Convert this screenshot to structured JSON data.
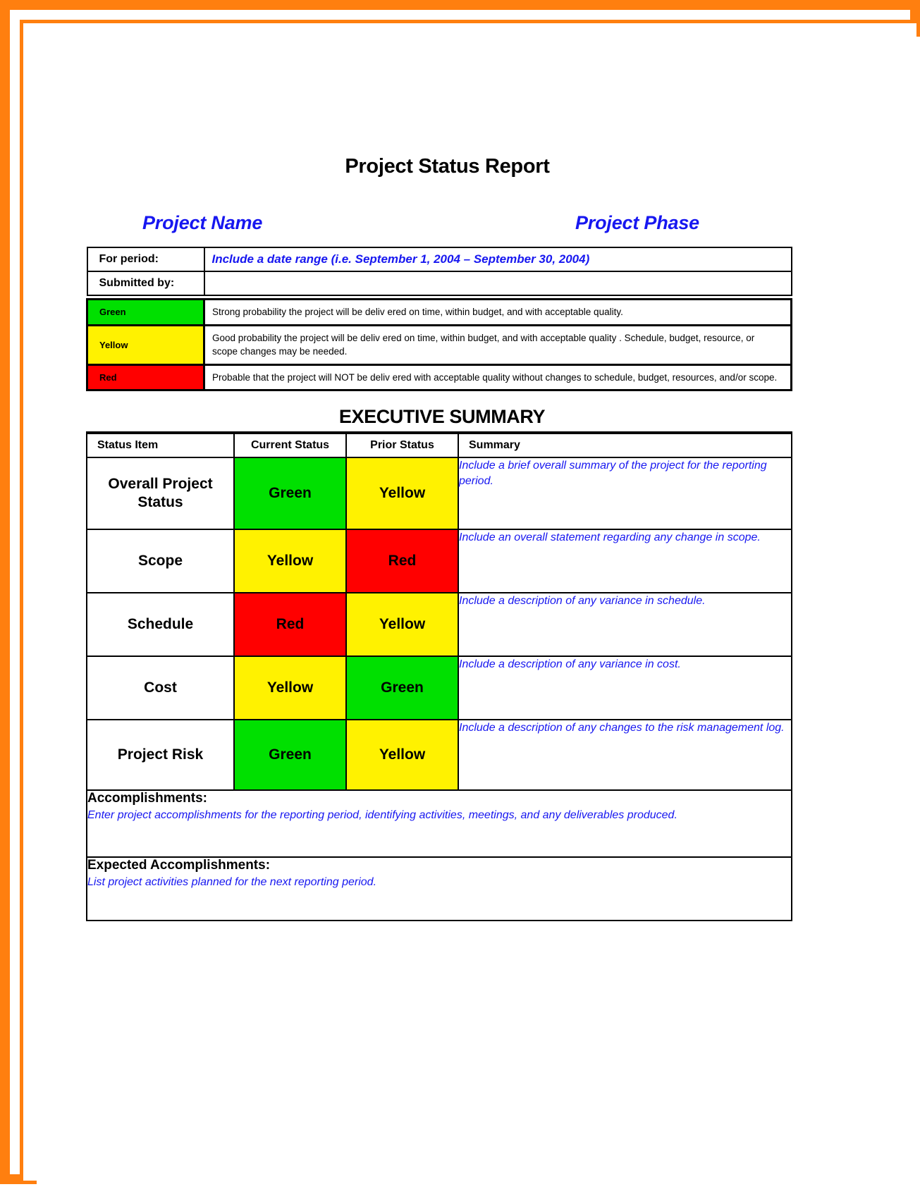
{
  "document": {
    "title": "Project Status Report",
    "project_name": "Project Name",
    "project_phase": "Project Phase",
    "executive_summary_title": "EXECUTIVE SUMMARY"
  },
  "header": {
    "for_period_label": "For period:",
    "for_period_value": "Include a date range (i.e. September 1, 2004 – September 30, 2004)",
    "submitted_by_label": "Submitted by:",
    "submitted_by_value": ""
  },
  "legend": {
    "rows": [
      {
        "color_label": "Green",
        "color_hex": "#00E000",
        "description": "Strong probability  the project will be deliv ered on time, within budget, and with acceptable quality."
      },
      {
        "color_label": "Yellow",
        "color_hex": "#FFF200",
        "description": "Good probability the project will be deliv ered on time, within budget, and with acceptable quality . Schedule, budget, resource, or scope changes may be needed."
      },
      {
        "color_label": "Red",
        "color_hex": "#FF0000",
        "description": "Probable that the project will NOT be deliv ered with acceptable quality without changes to schedule, budget, resources, and/or scope."
      }
    ]
  },
  "exec_summary": {
    "columns": [
      "Status Item",
      "Current Status",
      "Prior Status",
      "Summary"
    ],
    "rows": [
      {
        "item": "Overall Project Status",
        "current_status": "Green",
        "current_color": "#00E000",
        "prior_status": "Yellow",
        "prior_color": "#FFF200",
        "summary": "Include a brief overall summary of the project for the reporting period."
      },
      {
        "item": "Scope",
        "current_status": "Yellow",
        "current_color": "#FFF200",
        "prior_status": "Red",
        "prior_color": "#FF0000",
        "summary": "Include an overall statement regarding any change in scope."
      },
      {
        "item": "Schedule",
        "current_status": "Red",
        "current_color": "#FF0000",
        "prior_status": "Yellow",
        "prior_color": "#FFF200",
        "summary": "Include a description of any variance in schedule."
      },
      {
        "item": "Cost",
        "current_status": "Yellow",
        "current_color": "#FFF200",
        "prior_status": "Green",
        "prior_color": "#00E000",
        "summary": "Include a description of any variance in cost."
      },
      {
        "item": "Project Risk",
        "current_status": "Green",
        "current_color": "#00E000",
        "prior_status": "Yellow",
        "prior_color": "#FFF200",
        "summary": "Include a description of any changes to the risk management log."
      }
    ]
  },
  "accomplishments": {
    "title": "Accomplishments:",
    "text": "Enter project accomplishments for the reporting period, identifying activities, meetings, and any deliverables produced."
  },
  "expected_accomplishments": {
    "title": "Expected Accomplishments:",
    "text": "List project activities planned for the next reporting period."
  },
  "theme": {
    "frame_orange": "#FF7F0F",
    "text_blue": "#1717F0",
    "green": "#00E000",
    "yellow": "#FFF200",
    "red": "#FF0000"
  }
}
